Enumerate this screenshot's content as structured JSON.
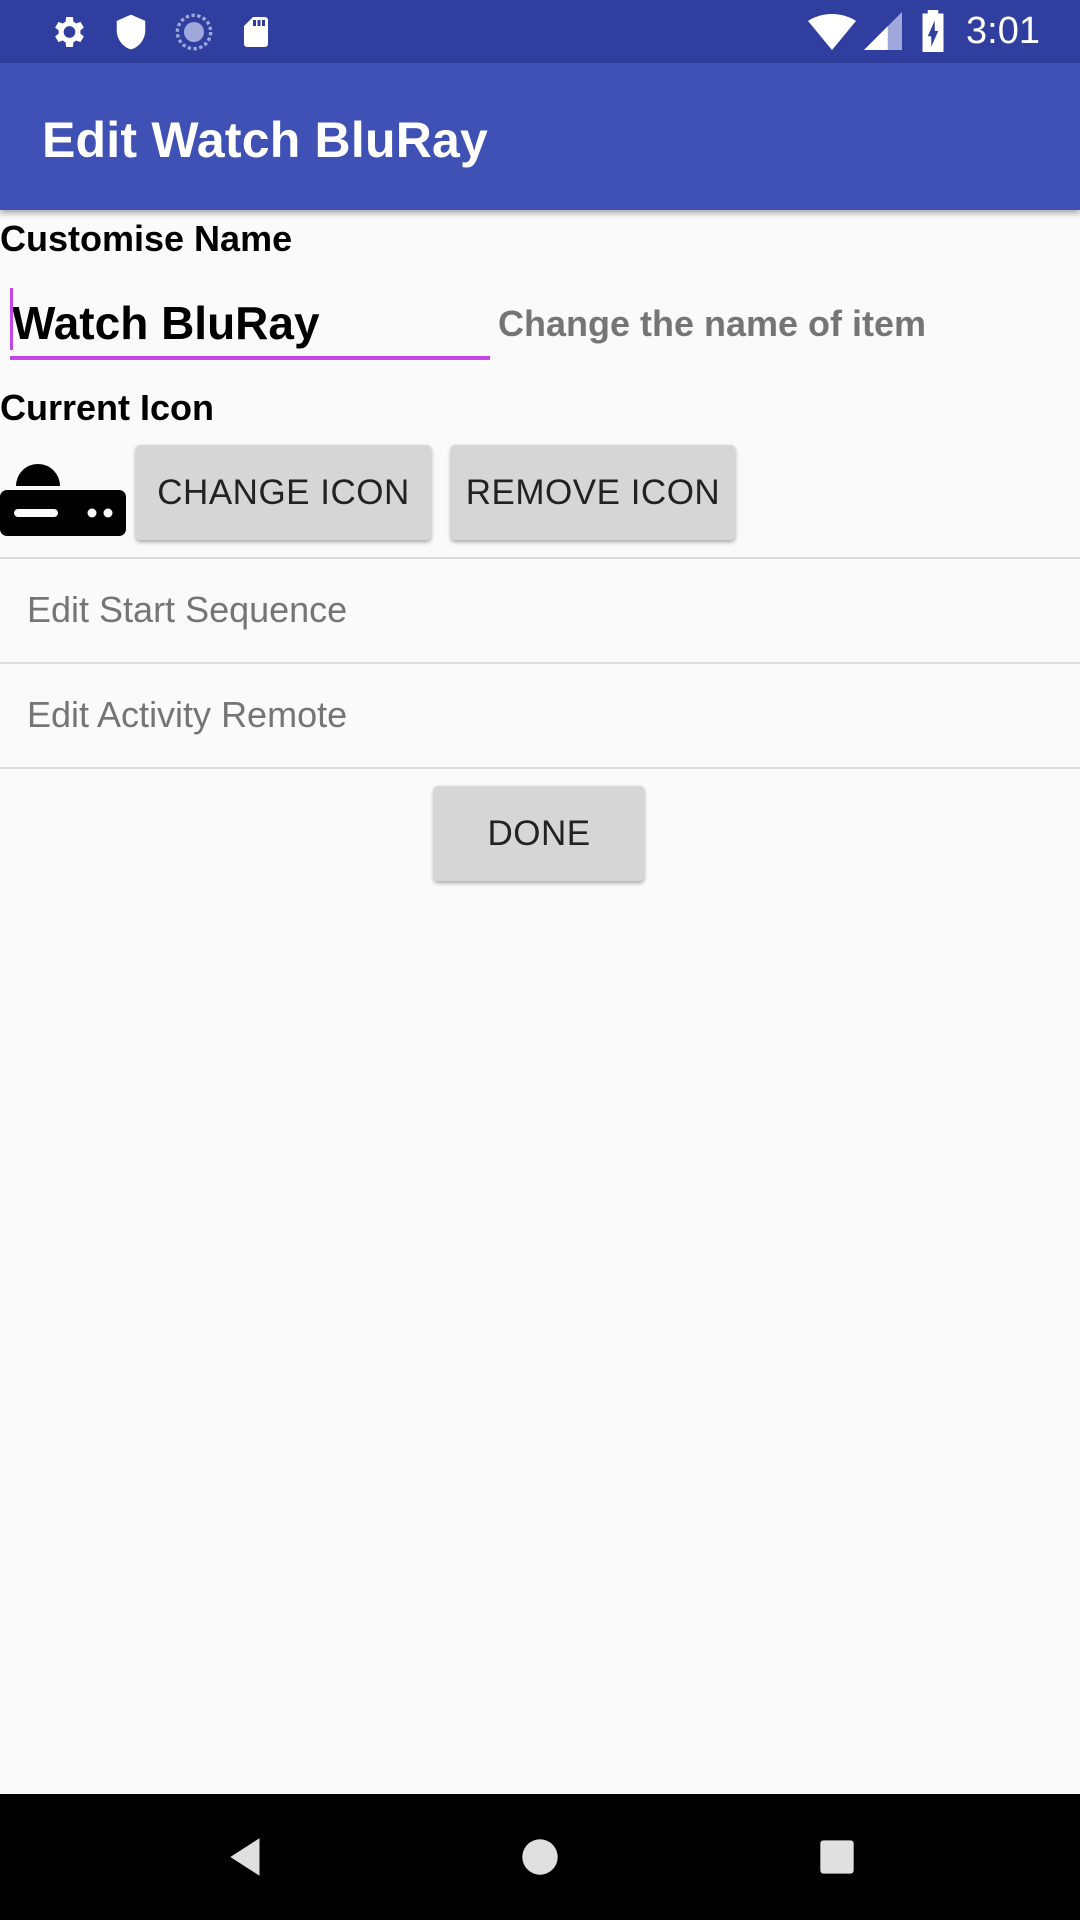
{
  "status_bar": {
    "time": "3:01",
    "icons": [
      "settings-icon",
      "shield-icon",
      "sync-icon",
      "sd-card-icon",
      "wifi-icon",
      "signal-icon",
      "battery-charging-icon"
    ]
  },
  "app_bar": {
    "title": "Edit Watch BluRay"
  },
  "customise_name": {
    "label": "Customise Name",
    "value": "Watch BluRay",
    "hint": "Change the name of item",
    "accent_color": "#c545e6"
  },
  "current_icon": {
    "label": "Current Icon",
    "icon": "bluray-player-icon",
    "change_label": "CHANGE ICON",
    "remove_label": "REMOVE ICON"
  },
  "rows": [
    {
      "label": "Edit Start Sequence"
    },
    {
      "label": "Edit Activity Remote"
    }
  ],
  "done_label": "DONE",
  "nav_bar": {
    "buttons": [
      "back-icon",
      "home-icon",
      "recents-icon"
    ]
  },
  "colors": {
    "status_bar": "#303f9f",
    "app_bar": "#3f51b5",
    "background": "#fafafa",
    "button": "#d6d6d6"
  }
}
